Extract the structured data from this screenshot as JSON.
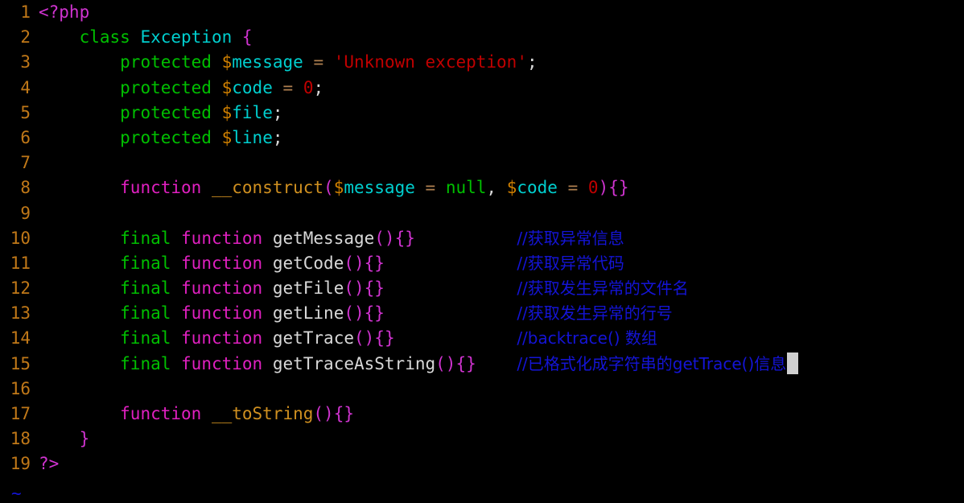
{
  "editor": {
    "name": "vim-php-source-view",
    "background_color": "#000000",
    "line_number_color": "#c07818",
    "cursor": {
      "glyph": "block-cursor",
      "color": "#d0d0d0",
      "line": 15
    },
    "tilde_marker": "~",
    "colors": {
      "php_tag": "#d033d0",
      "keyword_function": "#e020c0",
      "keyword_other": "#00c000",
      "classname": "#00cfcf",
      "sigil": "#d08000",
      "variable": "#00cfcf",
      "string": "#c00000",
      "number": "#c00000",
      "operator": "#b08050",
      "punctuation": "#d033d0",
      "identifier": "#d8d8d8",
      "magic_method": "#d09020",
      "comment": "#1414d6"
    }
  },
  "lines": [
    {
      "no": "1",
      "tokens": [
        {
          "t": "<?php",
          "c": "tok-php"
        }
      ]
    },
    {
      "no": "2",
      "tokens": [
        {
          "t": "    ",
          "c": "tok-plain"
        },
        {
          "t": "class",
          "c": "tok-kw2"
        },
        {
          "t": " ",
          "c": "tok-plain"
        },
        {
          "t": "Exception",
          "c": "tok-type"
        },
        {
          "t": " ",
          "c": "tok-plain"
        },
        {
          "t": "{",
          "c": "tok-punct"
        }
      ]
    },
    {
      "no": "3",
      "tokens": [
        {
          "t": "        ",
          "c": "tok-plain"
        },
        {
          "t": "protected",
          "c": "tok-kw2"
        },
        {
          "t": " ",
          "c": "tok-plain"
        },
        {
          "t": "$",
          "c": "tok-sigil"
        },
        {
          "t": "message",
          "c": "tok-var"
        },
        {
          "t": " ",
          "c": "tok-plain"
        },
        {
          "t": "=",
          "c": "tok-op"
        },
        {
          "t": " ",
          "c": "tok-plain"
        },
        {
          "t": "'Unknown exception'",
          "c": "tok-string"
        },
        {
          "t": ";",
          "c": "tok-plain"
        }
      ]
    },
    {
      "no": "4",
      "tokens": [
        {
          "t": "        ",
          "c": "tok-plain"
        },
        {
          "t": "protected",
          "c": "tok-kw2"
        },
        {
          "t": " ",
          "c": "tok-plain"
        },
        {
          "t": "$",
          "c": "tok-sigil"
        },
        {
          "t": "code",
          "c": "tok-var"
        },
        {
          "t": " ",
          "c": "tok-plain"
        },
        {
          "t": "=",
          "c": "tok-op"
        },
        {
          "t": " ",
          "c": "tok-plain"
        },
        {
          "t": "0",
          "c": "tok-number"
        },
        {
          "t": ";",
          "c": "tok-plain"
        }
      ]
    },
    {
      "no": "5",
      "tokens": [
        {
          "t": "        ",
          "c": "tok-plain"
        },
        {
          "t": "protected",
          "c": "tok-kw2"
        },
        {
          "t": " ",
          "c": "tok-plain"
        },
        {
          "t": "$",
          "c": "tok-sigil"
        },
        {
          "t": "file",
          "c": "tok-var"
        },
        {
          "t": ";",
          "c": "tok-plain"
        }
      ]
    },
    {
      "no": "6",
      "tokens": [
        {
          "t": "        ",
          "c": "tok-plain"
        },
        {
          "t": "protected",
          "c": "tok-kw2"
        },
        {
          "t": " ",
          "c": "tok-plain"
        },
        {
          "t": "$",
          "c": "tok-sigil"
        },
        {
          "t": "line",
          "c": "tok-var"
        },
        {
          "t": ";",
          "c": "tok-plain"
        }
      ]
    },
    {
      "no": "7",
      "tokens": []
    },
    {
      "no": "8",
      "tokens": [
        {
          "t": "        ",
          "c": "tok-plain"
        },
        {
          "t": "function",
          "c": "tok-keyword"
        },
        {
          "t": " ",
          "c": "tok-plain"
        },
        {
          "t": "__construct",
          "c": "tok-magic"
        },
        {
          "t": "(",
          "c": "tok-punct"
        },
        {
          "t": "$",
          "c": "tok-sigil"
        },
        {
          "t": "message",
          "c": "tok-var"
        },
        {
          "t": " ",
          "c": "tok-plain"
        },
        {
          "t": "=",
          "c": "tok-op"
        },
        {
          "t": " ",
          "c": "tok-plain"
        },
        {
          "t": "null",
          "c": "tok-kw2"
        },
        {
          "t": ", ",
          "c": "tok-plain"
        },
        {
          "t": "$",
          "c": "tok-sigil"
        },
        {
          "t": "code",
          "c": "tok-var"
        },
        {
          "t": " ",
          "c": "tok-plain"
        },
        {
          "t": "=",
          "c": "tok-op"
        },
        {
          "t": " ",
          "c": "tok-plain"
        },
        {
          "t": "0",
          "c": "tok-number"
        },
        {
          "t": ")",
          "c": "tok-punct"
        },
        {
          "t": "{}",
          "c": "tok-punct"
        }
      ]
    },
    {
      "no": "9",
      "tokens": []
    },
    {
      "no": "10",
      "tokens": [
        {
          "t": "        ",
          "c": "tok-plain"
        },
        {
          "t": "final",
          "c": "tok-kw2"
        },
        {
          "t": " ",
          "c": "tok-plain"
        },
        {
          "t": "function",
          "c": "tok-keyword"
        },
        {
          "t": " ",
          "c": "tok-plain"
        },
        {
          "t": "getMessage",
          "c": "tok-ident"
        },
        {
          "t": "()",
          "c": "tok-punct"
        },
        {
          "t": "{}",
          "c": "tok-punct"
        },
        {
          "t": "          ",
          "c": "tok-plain"
        },
        {
          "t": "//获取异常信息",
          "c": "tok-comment"
        }
      ]
    },
    {
      "no": "11",
      "tokens": [
        {
          "t": "        ",
          "c": "tok-plain"
        },
        {
          "t": "final",
          "c": "tok-kw2"
        },
        {
          "t": " ",
          "c": "tok-plain"
        },
        {
          "t": "function",
          "c": "tok-keyword"
        },
        {
          "t": " ",
          "c": "tok-plain"
        },
        {
          "t": "getCode",
          "c": "tok-ident"
        },
        {
          "t": "()",
          "c": "tok-punct"
        },
        {
          "t": "{}",
          "c": "tok-punct"
        },
        {
          "t": "             ",
          "c": "tok-plain"
        },
        {
          "t": "//获取异常代码",
          "c": "tok-comment"
        }
      ]
    },
    {
      "no": "12",
      "tokens": [
        {
          "t": "        ",
          "c": "tok-plain"
        },
        {
          "t": "final",
          "c": "tok-kw2"
        },
        {
          "t": " ",
          "c": "tok-plain"
        },
        {
          "t": "function",
          "c": "tok-keyword"
        },
        {
          "t": " ",
          "c": "tok-plain"
        },
        {
          "t": "getFile",
          "c": "tok-ident"
        },
        {
          "t": "()",
          "c": "tok-punct"
        },
        {
          "t": "{}",
          "c": "tok-punct"
        },
        {
          "t": "             ",
          "c": "tok-plain"
        },
        {
          "t": "//获取发生异常的文件名",
          "c": "tok-comment"
        }
      ]
    },
    {
      "no": "13",
      "tokens": [
        {
          "t": "        ",
          "c": "tok-plain"
        },
        {
          "t": "final",
          "c": "tok-kw2"
        },
        {
          "t": " ",
          "c": "tok-plain"
        },
        {
          "t": "function",
          "c": "tok-keyword"
        },
        {
          "t": " ",
          "c": "tok-plain"
        },
        {
          "t": "getLine",
          "c": "tok-ident"
        },
        {
          "t": "()",
          "c": "tok-punct"
        },
        {
          "t": "{}",
          "c": "tok-punct"
        },
        {
          "t": "             ",
          "c": "tok-plain"
        },
        {
          "t": "//获取发生异常的行号",
          "c": "tok-comment"
        }
      ]
    },
    {
      "no": "14",
      "tokens": [
        {
          "t": "        ",
          "c": "tok-plain"
        },
        {
          "t": "final",
          "c": "tok-kw2"
        },
        {
          "t": " ",
          "c": "tok-plain"
        },
        {
          "t": "function",
          "c": "tok-keyword"
        },
        {
          "t": " ",
          "c": "tok-plain"
        },
        {
          "t": "getTrace",
          "c": "tok-ident"
        },
        {
          "t": "()",
          "c": "tok-punct"
        },
        {
          "t": "{}",
          "c": "tok-punct"
        },
        {
          "t": "            ",
          "c": "tok-plain"
        },
        {
          "t": "//backtrace() 数组",
          "c": "tok-comment"
        }
      ]
    },
    {
      "no": "15",
      "tokens": [
        {
          "t": "        ",
          "c": "tok-plain"
        },
        {
          "t": "final",
          "c": "tok-kw2"
        },
        {
          "t": " ",
          "c": "tok-plain"
        },
        {
          "t": "function",
          "c": "tok-keyword"
        },
        {
          "t": " ",
          "c": "tok-plain"
        },
        {
          "t": "getTraceAsString",
          "c": "tok-ident"
        },
        {
          "t": "()",
          "c": "tok-punct"
        },
        {
          "t": "{}",
          "c": "tok-punct"
        },
        {
          "t": "    ",
          "c": "tok-plain"
        },
        {
          "t": "//已格式化成字符串的getTrace()信息",
          "c": "tok-comment"
        }
      ],
      "cursor": true
    },
    {
      "no": "16",
      "tokens": []
    },
    {
      "no": "17",
      "tokens": [
        {
          "t": "        ",
          "c": "tok-plain"
        },
        {
          "t": "function",
          "c": "tok-keyword"
        },
        {
          "t": " ",
          "c": "tok-plain"
        },
        {
          "t": "__toString",
          "c": "tok-magic"
        },
        {
          "t": "()",
          "c": "tok-punct"
        },
        {
          "t": "{}",
          "c": "tok-punct"
        }
      ]
    },
    {
      "no": "18",
      "tokens": [
        {
          "t": "    ",
          "c": "tok-plain"
        },
        {
          "t": "}",
          "c": "tok-punct"
        }
      ]
    },
    {
      "no": "19",
      "tokens": [
        {
          "t": "?>",
          "c": "tok-php"
        }
      ]
    }
  ]
}
